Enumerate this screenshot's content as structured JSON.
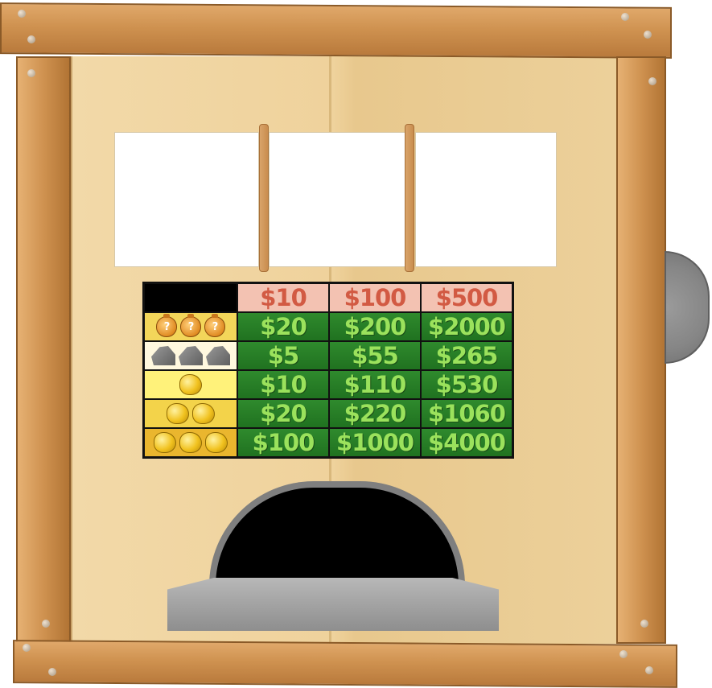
{
  "machine": {
    "header": [
      "$10",
      "$100",
      "$500"
    ],
    "rows": [
      {
        "symbol": "mystery-bag-icon",
        "count": 3,
        "payouts": [
          "$20",
          "$200",
          "$2000"
        ],
        "bg": "#f3d65a"
      },
      {
        "symbol": "rock-icon",
        "count": 3,
        "payouts": [
          "$5",
          "$55",
          "$265"
        ],
        "bg": "#fff8df"
      },
      {
        "symbol": "gold-nugget-icon",
        "count": 1,
        "payouts": [
          "$10",
          "$110",
          "$530"
        ],
        "bg": "#fff27a"
      },
      {
        "symbol": "gold-nugget-icon",
        "count": 2,
        "payouts": [
          "$20",
          "$220",
          "$1060"
        ],
        "bg": "#f3d34a"
      },
      {
        "symbol": "gold-nugget-icon",
        "count": 3,
        "payouts": [
          "$100",
          "$1000",
          "$4000"
        ],
        "bg": "#eab62e"
      }
    ],
    "bag_glyph": "?",
    "colors": {
      "payout_bg": "#2f8a2d",
      "payout_text": "#9be25c",
      "header_bg": "#f3c2b2",
      "header_text": "#d25a43",
      "wood": "#cf9250"
    }
  }
}
